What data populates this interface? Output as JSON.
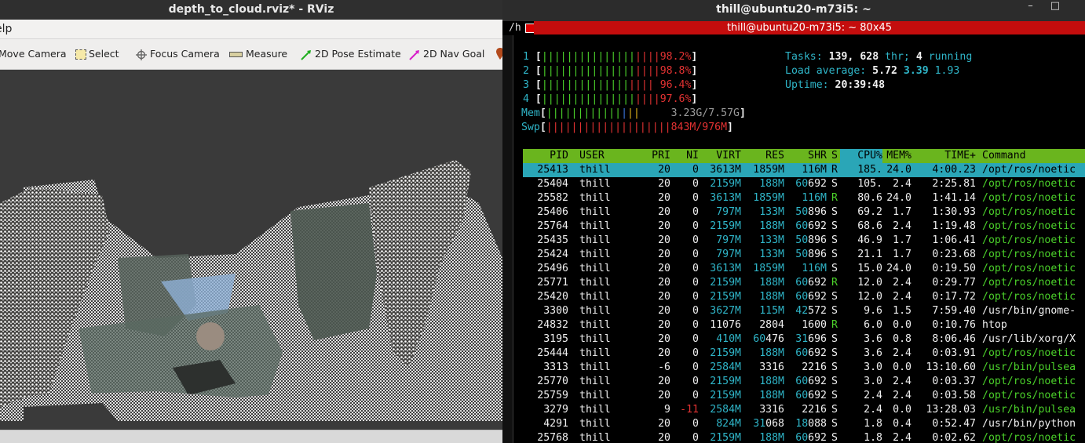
{
  "rviz": {
    "title": "depth_to_cloud.rviz* - RViz",
    "menu_label": "elp",
    "tools": [
      {
        "label": "Move Camera"
      },
      {
        "label": "Select"
      },
      {
        "label": "Focus Camera"
      },
      {
        "label": "Measure"
      },
      {
        "label": "2D Pose Estimate"
      },
      {
        "label": "2D Nav Goal"
      }
    ]
  },
  "terminal": {
    "title": "thill@ubuntu20-m73i5: ~",
    "tab_prefix": "/h",
    "tab_title": "thill@ubuntu20-m73i5: ~ 80x45",
    "cpus": [
      {
        "id": "1",
        "pct": "98.2%",
        "fill": 0.982
      },
      {
        "id": "2",
        "pct": "98.8%",
        "fill": 0.988
      },
      {
        "id": "3",
        "pct": "96.4%",
        "fill": 0.964
      },
      {
        "id": "4",
        "pct": "97.6%",
        "fill": 0.976
      }
    ],
    "mem": {
      "label": "Mem",
      "value": "3.23G/7.57G"
    },
    "swp": {
      "label": "Swp",
      "value": "843M/976M"
    },
    "tasks": {
      "label": "Tasks:",
      "count": "139,",
      "thr": "628",
      "thr_label": "thr;",
      "running": "4",
      "running_label": "running"
    },
    "load": {
      "label": "Load average:",
      "v1": "5.72",
      "v2": "3.39",
      "v3": "1.93"
    },
    "uptime": {
      "label": "Uptime:",
      "value": "20:39:48"
    },
    "headers": [
      "PID",
      "USER",
      "PRI",
      "NI",
      "VIRT",
      "RES",
      "SHR",
      "S",
      "CPU%",
      "MEM%",
      "TIME+",
      "Command"
    ],
    "rows": [
      [
        "25413",
        "thill",
        "20",
        "0",
        "3613M",
        "1859M",
        "116M",
        "R",
        "185.",
        "24.0",
        "4:00.23",
        "/opt/ros/noetic"
      ],
      [
        "25404",
        "thill",
        "20",
        "0",
        "2159M",
        "188M",
        "60692",
        "S",
        "105.",
        "2.4",
        "2:25.81",
        "/opt/ros/noetic"
      ],
      [
        "25582",
        "thill",
        "20",
        "0",
        "3613M",
        "1859M",
        "116M",
        "R",
        "80.6",
        "24.0",
        "1:41.14",
        "/opt/ros/noetic"
      ],
      [
        "25406",
        "thill",
        "20",
        "0",
        "797M",
        "133M",
        "50896",
        "S",
        "69.2",
        "1.7",
        "1:30.93",
        "/opt/ros/noetic"
      ],
      [
        "25764",
        "thill",
        "20",
        "0",
        "2159M",
        "188M",
        "60692",
        "S",
        "68.6",
        "2.4",
        "1:19.48",
        "/opt/ros/noetic"
      ],
      [
        "25435",
        "thill",
        "20",
        "0",
        "797M",
        "133M",
        "50896",
        "S",
        "46.9",
        "1.7",
        "1:06.41",
        "/opt/ros/noetic"
      ],
      [
        "25424",
        "thill",
        "20",
        "0",
        "797M",
        "133M",
        "50896",
        "S",
        "21.1",
        "1.7",
        "0:23.68",
        "/opt/ros/noetic"
      ],
      [
        "25496",
        "thill",
        "20",
        "0",
        "3613M",
        "1859M",
        "116M",
        "S",
        "15.0",
        "24.0",
        "0:19.50",
        "/opt/ros/noetic"
      ],
      [
        "25771",
        "thill",
        "20",
        "0",
        "2159M",
        "188M",
        "60692",
        "R",
        "12.0",
        "2.4",
        "0:29.77",
        "/opt/ros/noetic"
      ],
      [
        "25420",
        "thill",
        "20",
        "0",
        "2159M",
        "188M",
        "60692",
        "S",
        "12.0",
        "2.4",
        "0:17.72",
        "/opt/ros/noetic"
      ],
      [
        "3300",
        "thill",
        "20",
        "0",
        "3627M",
        "115M",
        "42572",
        "S",
        "9.6",
        "1.5",
        "7:59.40",
        "/usr/bin/gnome-"
      ],
      [
        "24832",
        "thill",
        "20",
        "0",
        "11076",
        "2804",
        "1600",
        "R",
        "6.0",
        "0.0",
        "0:10.76",
        "htop"
      ],
      [
        "3195",
        "thill",
        "20",
        "0",
        "410M",
        "60476",
        "31696",
        "S",
        "3.6",
        "0.8",
        "8:06.46",
        "/usr/lib/xorg/X"
      ],
      [
        "25444",
        "thill",
        "20",
        "0",
        "2159M",
        "188M",
        "60692",
        "S",
        "3.6",
        "2.4",
        "0:03.91",
        "/opt/ros/noetic"
      ],
      [
        "3313",
        "thill",
        "-6",
        "0",
        "2584M",
        "3316",
        "2216",
        "S",
        "3.0",
        "0.0",
        "13:10.60",
        "/usr/bin/pulsea"
      ],
      [
        "25770",
        "thill",
        "20",
        "0",
        "2159M",
        "188M",
        "60692",
        "S",
        "3.0",
        "2.4",
        "0:03.37",
        "/opt/ros/noetic"
      ],
      [
        "25759",
        "thill",
        "20",
        "0",
        "2159M",
        "188M",
        "60692",
        "S",
        "2.4",
        "2.4",
        "0:03.58",
        "/opt/ros/noetic"
      ],
      [
        "3279",
        "thill",
        "9",
        "-11",
        "2584M",
        "3316",
        "2216",
        "S",
        "2.4",
        "0.0",
        "13:28.03",
        "/usr/bin/pulsea"
      ],
      [
        "4291",
        "thill",
        "20",
        "0",
        "824M",
        "31068",
        "18088",
        "S",
        "1.8",
        "0.4",
        "0:52.47",
        "/usr/bin/python"
      ],
      [
        "25768",
        "thill",
        "20",
        "0",
        "2159M",
        "188M",
        "60692",
        "S",
        "1.8",
        "2.4",
        "0:02.62",
        "/opt/ros/noetic"
      ]
    ]
  }
}
